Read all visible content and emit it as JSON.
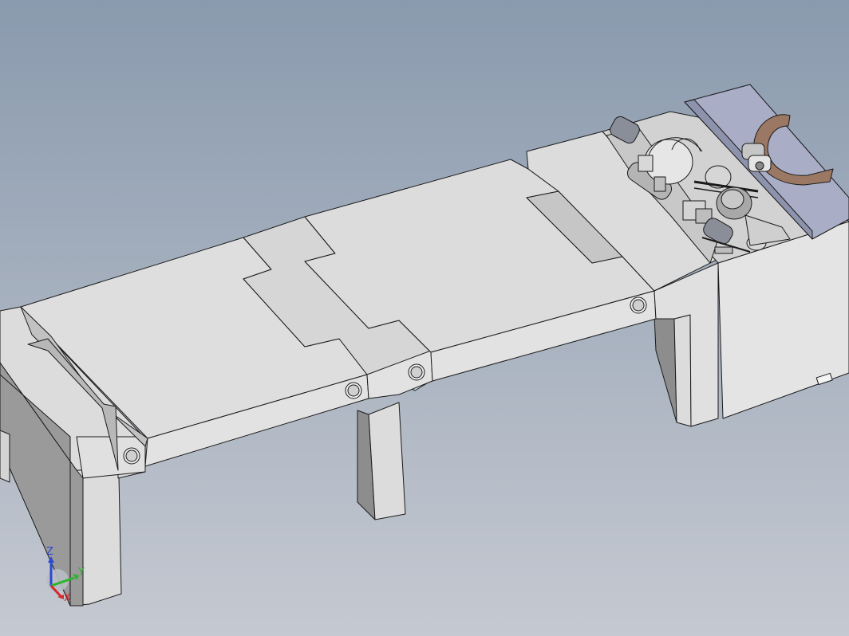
{
  "viewport": {
    "background_top": "#8a9aae",
    "background_bottom": "#c5c9d1",
    "model_face_color": "#d8d8d8",
    "model_side_color": "#9a9a9a",
    "model_edge_color": "#1a1a1a",
    "fixture_plate_color": "#a9adc6",
    "yoke_part_color": "#9b7863"
  },
  "triad": {
    "icon": "coordinate-triad-icon",
    "x_label": "X",
    "y_label": "Y",
    "z_label": "Z",
    "x_color": "#d42a2a",
    "y_color": "#2bb52b",
    "z_color": "#2a4ad4"
  }
}
